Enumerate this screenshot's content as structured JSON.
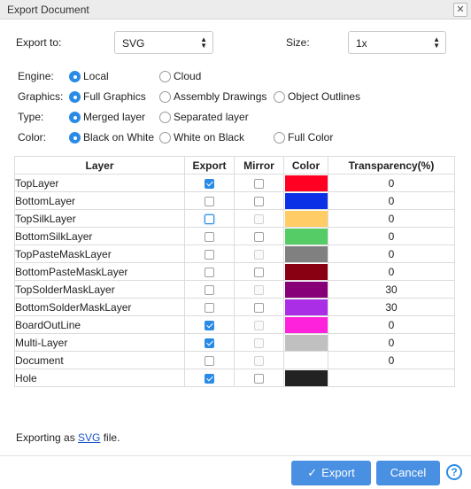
{
  "window": {
    "title": "Export Document",
    "close_glyph": "✕"
  },
  "form": {
    "export_to": {
      "label": "Export to:",
      "value": "SVG"
    },
    "size": {
      "label": "Size:",
      "value": "1x"
    },
    "engine": {
      "label": "Engine:",
      "options": [
        {
          "label": "Local",
          "selected": true
        },
        {
          "label": "Cloud",
          "selected": false
        }
      ]
    },
    "graphics": {
      "label": "Graphics:",
      "options": [
        {
          "label": "Full Graphics",
          "selected": true
        },
        {
          "label": "Assembly Drawings",
          "selected": false
        },
        {
          "label": "Object Outlines",
          "selected": false
        }
      ]
    },
    "type": {
      "label": "Type:",
      "options": [
        {
          "label": "Merged layer",
          "selected": true
        },
        {
          "label": "Separated layer",
          "selected": false
        }
      ]
    },
    "color": {
      "label": "Color:",
      "options": [
        {
          "label": "Black on White",
          "selected": true
        },
        {
          "label": "White on Black",
          "selected": false
        },
        {
          "label": "Full Color",
          "selected": false
        }
      ]
    }
  },
  "table": {
    "headers": [
      "Layer",
      "Export",
      "Mirror",
      "Color",
      "Transparency(%)"
    ],
    "rows": [
      {
        "layer": "TopLayer",
        "export": true,
        "mirror": false,
        "mirror_enabled": true,
        "color": "#ff0022",
        "transparency": "0"
      },
      {
        "layer": "BottomLayer",
        "export": false,
        "mirror": false,
        "mirror_enabled": true,
        "color": "#0a31e6",
        "transparency": "0"
      },
      {
        "layer": "TopSilkLayer",
        "export": false,
        "mirror": false,
        "mirror_enabled": false,
        "color": "#ffcc66",
        "transparency": "0",
        "focused": true
      },
      {
        "layer": "BottomSilkLayer",
        "export": false,
        "mirror": false,
        "mirror_enabled": true,
        "color": "#55cc66",
        "transparency": "0"
      },
      {
        "layer": "TopPasteMaskLayer",
        "export": false,
        "mirror": false,
        "mirror_enabled": false,
        "color": "#808080",
        "transparency": "0"
      },
      {
        "layer": "BottomPasteMaskLayer",
        "export": false,
        "mirror": false,
        "mirror_enabled": true,
        "color": "#880011",
        "transparency": "0"
      },
      {
        "layer": "TopSolderMaskLayer",
        "export": false,
        "mirror": false,
        "mirror_enabled": false,
        "color": "#880077",
        "transparency": "30"
      },
      {
        "layer": "BottomSolderMaskLayer",
        "export": false,
        "mirror": false,
        "mirror_enabled": true,
        "color": "#aa2ee6",
        "transparency": "30"
      },
      {
        "layer": "BoardOutLine",
        "export": true,
        "mirror": false,
        "mirror_enabled": false,
        "color": "#ff22dd",
        "transparency": "0"
      },
      {
        "layer": "Multi-Layer",
        "export": true,
        "mirror": false,
        "mirror_enabled": false,
        "color": "#c0c0c0",
        "transparency": "0"
      },
      {
        "layer": "Document",
        "export": false,
        "mirror": false,
        "mirror_enabled": false,
        "color": "#ffffff",
        "transparency": "0"
      },
      {
        "layer": "Hole",
        "export": true,
        "mirror": false,
        "mirror_enabled": true,
        "color": "#222222",
        "transparency": ""
      }
    ]
  },
  "status": {
    "prefix": "Exporting as ",
    "link": "SVG",
    "suffix": " file."
  },
  "buttons": {
    "export": "Export",
    "export_icon": "checkmark-icon",
    "cancel": "Cancel",
    "help": "?"
  },
  "colors": {
    "accent": "#2a8be6",
    "button": "#4a90e2"
  }
}
